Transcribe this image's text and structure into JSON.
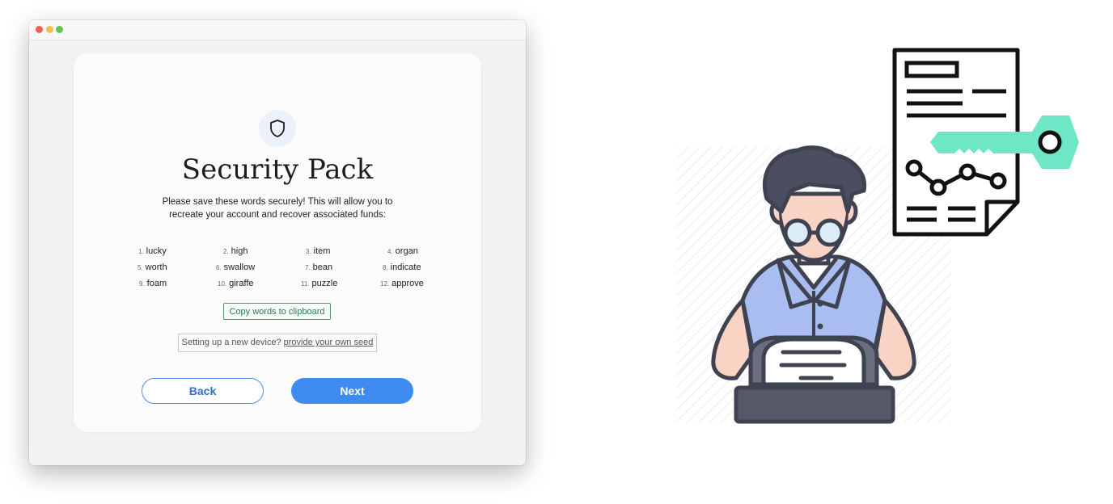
{
  "window": {
    "traffic_lights": [
      "close",
      "minimize",
      "zoom"
    ]
  },
  "card": {
    "icon": "shield-icon",
    "title": "Security Pack",
    "description": "Please save these words securely! This will allow you to recreate your account and recover associated funds:",
    "words": [
      {
        "num": "1.",
        "word": "lucky"
      },
      {
        "num": "2.",
        "word": "high"
      },
      {
        "num": "3.",
        "word": "item"
      },
      {
        "num": "4.",
        "word": "organ"
      },
      {
        "num": "5.",
        "word": "worth"
      },
      {
        "num": "6.",
        "word": "swallow"
      },
      {
        "num": "7.",
        "word": "bean"
      },
      {
        "num": "8.",
        "word": "indicate"
      },
      {
        "num": "9.",
        "word": "foam"
      },
      {
        "num": "10.",
        "word": "giraffe"
      },
      {
        "num": "11.",
        "word": "puzzle"
      },
      {
        "num": "12.",
        "word": "approve"
      }
    ],
    "copy_label": "Copy words to clipboard",
    "seed_prompt": "Setting up a new device?",
    "seed_link": "provide your own seed",
    "back_label": "Back",
    "next_label": "Next"
  },
  "illustration": {
    "subject": "person-at-typewriter-illustration",
    "document": "document-with-key-icon",
    "colors": {
      "key": "#6ee7c7",
      "shirt": "#a9bdf0",
      "hair": "#4b4e5e"
    }
  },
  "colors": {
    "primary": "#3e8cf0",
    "copy_green": "#2e7d46"
  }
}
